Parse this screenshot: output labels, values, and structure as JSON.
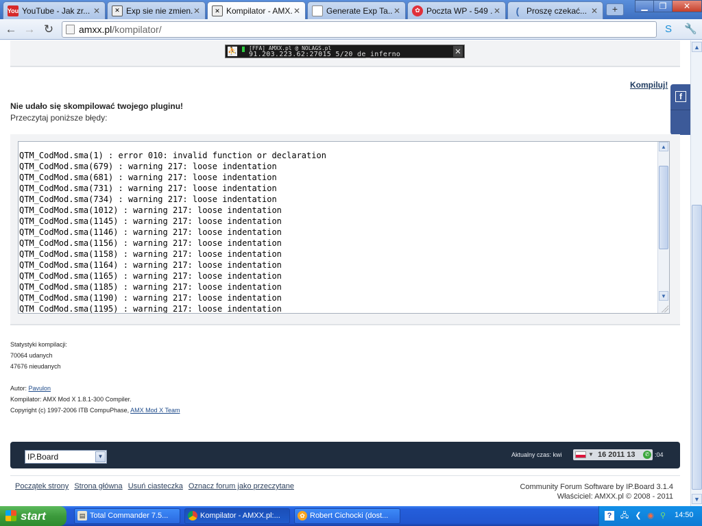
{
  "browser": {
    "tabs": [
      {
        "label": "YouTube - Jak zr...",
        "icon": "youtube-icon"
      },
      {
        "label": "Exp sie nie zmien...",
        "icon": "amxx-icon"
      },
      {
        "label": "Kompilator - AMX...",
        "icon": "amxx-icon",
        "active": true
      },
      {
        "label": "Generate Exp Ta...",
        "icon": "page-icon"
      },
      {
        "label": "Poczta WP - 549 ...",
        "icon": "wp-mail-icon"
      },
      {
        "label": "Proszę czekać...",
        "icon": "loading-icon"
      }
    ],
    "url_host": "amxx.pl",
    "url_path": "/kompilator/"
  },
  "page": {
    "banner": {
      "line1": "[FFA] AMXX.pl @ NOLAGS.pl",
      "line2": "91.203.223.62:27015 5/20 de_inferno"
    },
    "compile_link": "Kompiluj!",
    "error_title": "Nie udało się skompilować twojego pluginu!",
    "error_subtitle": "Przeczytaj poniższe błędy:",
    "log_lines": [
      "QTM_CodMod.sma(1) : error 010: invalid function or declaration",
      "QTM_CodMod.sma(679) : warning 217: loose indentation",
      "QTM_CodMod.sma(681) : warning 217: loose indentation",
      "QTM_CodMod.sma(731) : warning 217: loose indentation",
      "QTM_CodMod.sma(734) : warning 217: loose indentation",
      "QTM_CodMod.sma(1012) : warning 217: loose indentation",
      "QTM_CodMod.sma(1145) : warning 217: loose indentation",
      "QTM_CodMod.sma(1146) : warning 217: loose indentation",
      "QTM_CodMod.sma(1156) : warning 217: loose indentation",
      "QTM_CodMod.sma(1158) : warning 217: loose indentation",
      "QTM_CodMod.sma(1164) : warning 217: loose indentation",
      "QTM_CodMod.sma(1165) : warning 217: loose indentation",
      "QTM_CodMod.sma(1185) : warning 217: loose indentation",
      "QTM_CodMod.sma(1190) : warning 217: loose indentation",
      "QTM_CodMod.sma(1195) : warning 217: loose indentation"
    ],
    "stats": {
      "heading": "Statystyki kompilacji:",
      "success": "70064 udanych",
      "failed": "47676 nieudanych",
      "author_label": "Autor:",
      "author_name": "Pavulon",
      "compiler": "Kompilator: AMX Mod X 1.8.1-300 Compiler.",
      "copyright_prefix": "Copyright (c) 1997-2006 ITB CompuPhase,",
      "copyright_link": "AMX Mod X Team"
    },
    "footer": {
      "skin_value": "IP.Board",
      "time_label": "Aktualny czas: kwi",
      "time_value": "16 2011 13",
      "time_suffix": ":04",
      "links": [
        "Początek strony",
        "Strona główna",
        "Usuń ciasteczka",
        "Oznacz forum jako przeczytane"
      ],
      "credit_line1": "Community Forum Software by IP.Board 3.1.4",
      "credit_line2": "Właściciel: AMXX.pl © 2008 - 2011"
    }
  },
  "taskbar": {
    "start_label": "start",
    "buttons": [
      {
        "label": "Total Commander 7.5...",
        "icon": "total-commander-icon"
      },
      {
        "label": "Kompilator - AMXX.pl:...",
        "icon": "chrome-icon",
        "active": true
      },
      {
        "label": "Robert Cichocki (dost...",
        "icon": "gadu-gadu-icon"
      }
    ],
    "clock": "14:50"
  },
  "colors": {
    "footer_bar": "#1f2d3f",
    "link": "#1e3a5f",
    "taskbar": "#245edb",
    "start_button": "#3c9a3c"
  }
}
